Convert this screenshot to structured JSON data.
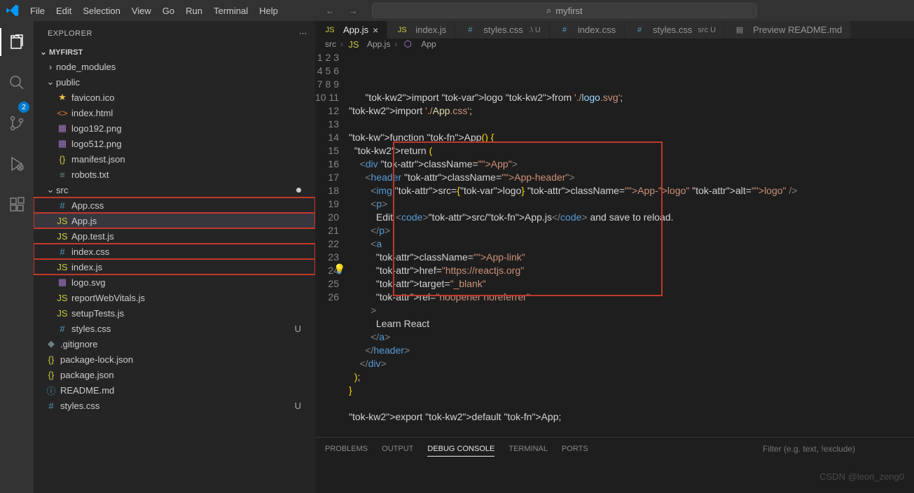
{
  "titlebar": {
    "menu": [
      "File",
      "Edit",
      "Selection",
      "View",
      "Go",
      "Run",
      "Terminal",
      "Help"
    ],
    "search_text": "myfirst"
  },
  "activity_bar": {
    "badge_count": "2"
  },
  "sidebar": {
    "header": "EXPLORER",
    "project": "MYFIRST",
    "tree": [
      {
        "depth": 1,
        "type": "folder",
        "open": false,
        "icon": "chevron",
        "label": "node_modules"
      },
      {
        "depth": 1,
        "type": "folder",
        "open": true,
        "icon": "chevron",
        "label": "public"
      },
      {
        "depth": 2,
        "type": "file",
        "icon": "star",
        "label": "favicon.ico"
      },
      {
        "depth": 2,
        "type": "file",
        "icon": "html",
        "label": "index.html"
      },
      {
        "depth": 2,
        "type": "file",
        "icon": "png",
        "label": "logo192.png"
      },
      {
        "depth": 2,
        "type": "file",
        "icon": "png",
        "label": "logo512.png"
      },
      {
        "depth": 2,
        "type": "file",
        "icon": "json",
        "label": "manifest.json"
      },
      {
        "depth": 2,
        "type": "file",
        "icon": "txt",
        "label": "robots.txt"
      },
      {
        "depth": 1,
        "type": "folder",
        "open": true,
        "icon": "chevron",
        "label": "src",
        "modified": true
      },
      {
        "depth": 2,
        "type": "file",
        "icon": "css",
        "label": "App.css",
        "highlighted": true
      },
      {
        "depth": 2,
        "type": "file",
        "icon": "js",
        "label": "App.js",
        "selected": true,
        "highlighted": true
      },
      {
        "depth": 2,
        "type": "file",
        "icon": "js",
        "label": "App.test.js"
      },
      {
        "depth": 2,
        "type": "file",
        "icon": "css",
        "label": "index.css",
        "highlighted": true
      },
      {
        "depth": 2,
        "type": "file",
        "icon": "js",
        "label": "index.js",
        "highlighted": true
      },
      {
        "depth": 2,
        "type": "file",
        "icon": "svg",
        "label": "logo.svg"
      },
      {
        "depth": 2,
        "type": "file",
        "icon": "js",
        "label": "reportWebVitals.js"
      },
      {
        "depth": 2,
        "type": "file",
        "icon": "js",
        "label": "setupTests.js"
      },
      {
        "depth": 2,
        "type": "file",
        "icon": "css",
        "label": "styles.css",
        "status": "U"
      },
      {
        "depth": 1,
        "type": "file",
        "icon": "git",
        "label": ".gitignore"
      },
      {
        "depth": 1,
        "type": "file",
        "icon": "json",
        "label": "package-lock.json"
      },
      {
        "depth": 1,
        "type": "file",
        "icon": "json",
        "label": "package.json"
      },
      {
        "depth": 1,
        "type": "file",
        "icon": "readme",
        "label": "README.md"
      },
      {
        "depth": 1,
        "type": "file",
        "icon": "css",
        "label": "styles.css",
        "status": "U"
      }
    ]
  },
  "tabs": [
    {
      "icon": "js",
      "label": "App.js",
      "active": true,
      "close": true
    },
    {
      "icon": "js",
      "label": "index.js"
    },
    {
      "icon": "css",
      "label": "styles.css",
      "status": ".\\ U"
    },
    {
      "icon": "css",
      "label": "index.css"
    },
    {
      "icon": "css",
      "label": "styles.css",
      "status": "src U"
    },
    {
      "icon": "preview",
      "label": "Preview README.md"
    }
  ],
  "breadcrumb": [
    "src",
    "App.js",
    "App"
  ],
  "code": {
    "line_count": 26,
    "lines": [
      "import logo from './logo.svg';",
      "import './App.css';",
      "",
      "function App() {",
      "  return (",
      "    <div className=\"App\">",
      "      <header className=\"App-header\">",
      "        <img src={logo} className=\"App-logo\" alt=\"logo\" />",
      "        <p>",
      "          Edit <code>src/App.js</code> and save to reload.",
      "        </p>",
      "        <a",
      "          className=\"App-link\"",
      "          href=\"https://reactjs.org\"",
      "          target=\"_blank\"",
      "          rel=\"noopener noreferrer\"",
      "        >",
      "          Learn React",
      "        </a>",
      "      </header>",
      "    </div>",
      "  );",
      "}",
      "",
      "export default App;",
      ""
    ]
  },
  "panel": {
    "tabs": [
      "PROBLEMS",
      "OUTPUT",
      "DEBUG CONSOLE",
      "TERMINAL",
      "PORTS"
    ],
    "active_tab": "DEBUG CONSOLE",
    "filter_placeholder": "Filter (e.g. text, !exclude)"
  },
  "watermark": "CSDN @leon_zeng0"
}
